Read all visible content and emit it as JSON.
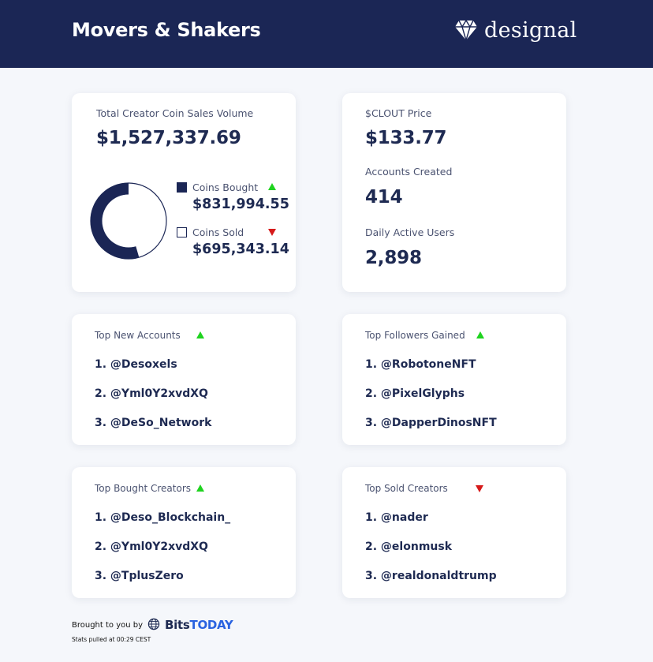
{
  "header": {
    "title": "Movers & Shakers",
    "brand": "designal",
    "logo_icon": "diamond-icon",
    "bg_color": "#1b2655"
  },
  "sales": {
    "label": "Total Creator Coin Sales Volume",
    "total": "$1,527,337.69",
    "bought_label": "Coins Bought",
    "bought_value": "$831,994.55",
    "sold_label": "Coins Sold",
    "sold_value": "$695,343.14",
    "chart_data": {
      "type": "pie",
      "categories": [
        "Coins Bought",
        "Coins Sold"
      ],
      "values": [
        831994.55,
        695343.14
      ],
      "colors": [
        "#1b2655",
        "#ffffff"
      ]
    }
  },
  "stats": {
    "clout_label": "$CLOUT Price",
    "clout_value": "$133.77",
    "accounts_label": "Accounts Created",
    "accounts_value": "414",
    "dau_label": "Daily Active Users",
    "dau_value": "2,898"
  },
  "top_new_accounts": {
    "title": "Top New Accounts",
    "trend": "up",
    "items": [
      "1. @Desoxels",
      "2. @Yml0Y2xvdXQ",
      "3. @DeSo_Network"
    ]
  },
  "top_followers": {
    "title": "Top Followers Gained",
    "trend": "up",
    "items": [
      "1. @RobotoneNFT",
      "2. @PixelGlyphs",
      "3. @DapperDinosNFT"
    ]
  },
  "top_bought": {
    "title": "Top Bought Creators",
    "trend": "up",
    "items": [
      "1. @Deso_Blockchain_",
      "2. @Yml0Y2xvdXQ",
      "3. @TplusZero"
    ]
  },
  "top_sold": {
    "title": "Top Sold Creators",
    "trend": "down",
    "items": [
      "1. @nader",
      "2. @elonmusk",
      "3. @realdonaldtrump"
    ]
  },
  "footer": {
    "brought_by": "Brought to you by",
    "globe_icon": "globe-icon",
    "brand_a": "Bits",
    "brand_b": "TODAY",
    "stats_time": "Stats pulled at 00:29 CEST"
  },
  "colors": {
    "up": "#1fd31f",
    "down": "#d61a1a",
    "navy": "#1b2655",
    "accent_blue": "#2a63e0"
  }
}
